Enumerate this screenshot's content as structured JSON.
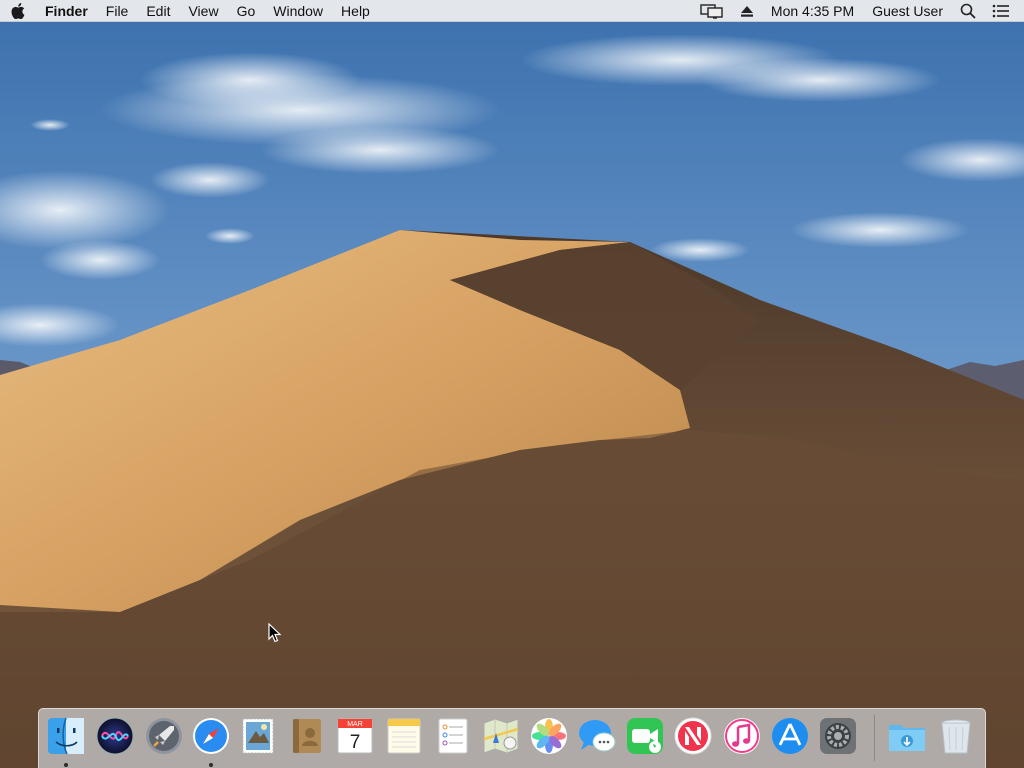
{
  "menubar": {
    "apple_icon": "apple-logo-icon",
    "app_name": "Finder",
    "menus": [
      "File",
      "Edit",
      "View",
      "Go",
      "Window",
      "Help"
    ],
    "status_icons": [
      "airplay-display-icon",
      "eject-icon"
    ],
    "clock": "Mon 4:35 PM",
    "user": "Guest User",
    "spotlight_icon": "search-icon",
    "notification_icon": "notification-center-icon"
  },
  "dock": {
    "apps": [
      {
        "name": "Finder",
        "icon": "finder-icon",
        "running": true
      },
      {
        "name": "Siri",
        "icon": "siri-icon",
        "running": false
      },
      {
        "name": "Launchpad",
        "icon": "launchpad-rocket-icon",
        "running": false
      },
      {
        "name": "Safari",
        "icon": "safari-compass-icon",
        "running": true
      },
      {
        "name": "Mail",
        "icon": "mail-stamp-icon",
        "running": false
      },
      {
        "name": "Contacts",
        "icon": "contacts-book-icon",
        "running": false
      },
      {
        "name": "Calendar",
        "icon": "calendar-icon",
        "running": false
      },
      {
        "name": "Notes",
        "icon": "notes-icon",
        "running": false
      },
      {
        "name": "Reminders",
        "icon": "reminders-icon",
        "running": false
      },
      {
        "name": "Maps",
        "icon": "maps-icon",
        "running": false
      },
      {
        "name": "Photos",
        "icon": "photos-flower-icon",
        "running": false
      },
      {
        "name": "Messages",
        "icon": "messages-bubble-icon",
        "running": false
      },
      {
        "name": "FaceTime",
        "icon": "facetime-camera-icon",
        "running": false
      },
      {
        "name": "News",
        "icon": "news-icon",
        "running": false
      },
      {
        "name": "iTunes",
        "icon": "itunes-music-icon",
        "running": false
      },
      {
        "name": "App Store",
        "icon": "app-store-icon",
        "running": false
      },
      {
        "name": "System Preferences",
        "icon": "system-preferences-gear-icon",
        "running": false
      }
    ],
    "calendar_month": "MAR",
    "calendar_day": "7",
    "stacks": [
      {
        "name": "Downloads",
        "icon": "downloads-folder-icon"
      },
      {
        "name": "Trash",
        "icon": "trash-icon"
      }
    ]
  },
  "colors": {
    "sky_top": "#3f73b0",
    "sky_bottom": "#9fc0e0",
    "dune_light": "#d9a868",
    "dune_shadow": "#5e4632",
    "menubar_bg": "#eeeef0"
  }
}
